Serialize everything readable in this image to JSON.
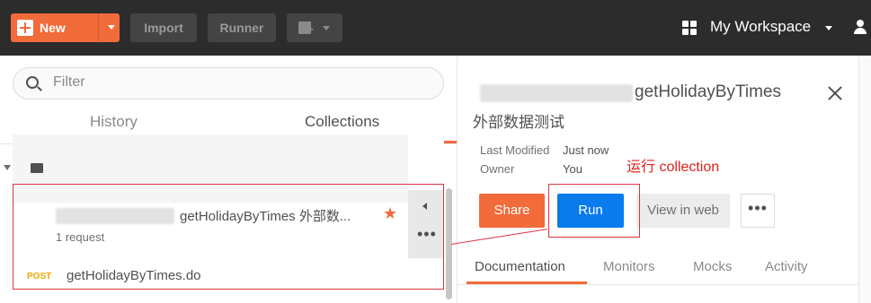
{
  "toolbar": {
    "new_label": "New",
    "import_label": "Import",
    "runner_label": "Runner",
    "workspace_label": "My Workspace"
  },
  "sidebar": {
    "filter_placeholder": "Filter",
    "tabs": [
      {
        "label": "History",
        "active": false
      },
      {
        "label": "Collections",
        "active": true
      }
    ],
    "collection": {
      "name": "getHolidayByTimes 外部数...",
      "request_count": "1 request",
      "starred": true,
      "requests": [
        {
          "method": "POST",
          "name": "getHolidayByTimes.do"
        }
      ]
    }
  },
  "panel": {
    "title": "getHolidayByTimes",
    "subtitle": "外部数据测试",
    "meta": [
      {
        "label": "Last Modified",
        "value": "Just now"
      },
      {
        "label": "Owner",
        "value": "You"
      }
    ],
    "annotation": "运行 collection",
    "buttons": {
      "share": "Share",
      "run": "Run",
      "view_in_web": "View in web"
    },
    "tabs": [
      {
        "label": "Documentation",
        "active": true
      },
      {
        "label": "Monitors",
        "active": false
      },
      {
        "label": "Mocks",
        "active": false
      },
      {
        "label": "Activity",
        "active": false
      }
    ]
  },
  "colors": {
    "accent": "#f26b3a",
    "run_button": "#097bed",
    "annotation": "#e0201b",
    "topbar": "#2c2c2c"
  },
  "icons": [
    "plus-icon",
    "new-window-icon",
    "workspace-grid-icon",
    "invite-icon",
    "search-icon",
    "new-collection-icon",
    "folder-icon",
    "star-icon",
    "collapse-icon",
    "more-icon",
    "close-icon"
  ]
}
